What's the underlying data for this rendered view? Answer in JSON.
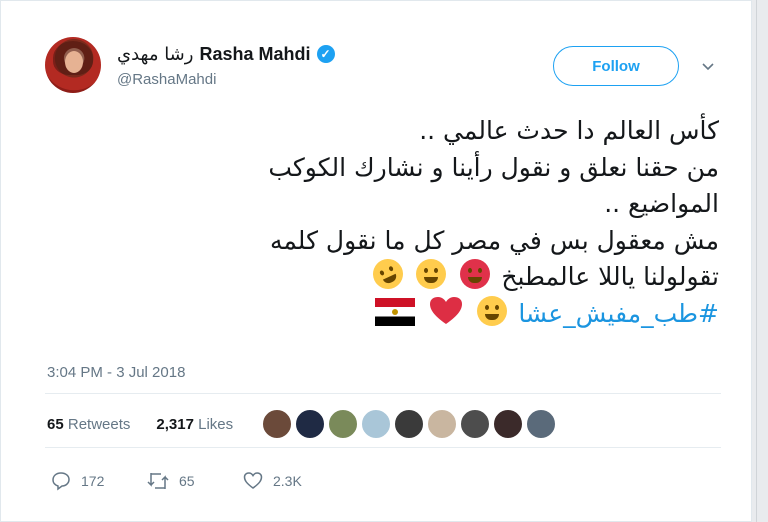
{
  "author": {
    "name_arabic": "رشا مهدي",
    "name_english": "Rasha Mahdi",
    "handle": "@RashaMahdi",
    "verified": true
  },
  "follow_button": {
    "label": "Follow"
  },
  "more_menu": {
    "icon": "chevron-down-icon"
  },
  "tweet": {
    "lines": [
      "كأس العالم دا حدث عالمي ..",
      "من حقنا نعلق و نقول رأينا و نشارك الكوكب",
      "المواضيع ..",
      "مش معقول بس في مصر كل ما نقول كلمه",
      "تقولولنا ياللا عالمطبخ"
    ],
    "line5_emojis": [
      "angry-face",
      "grinning-face",
      "rolling-on-floor-laughing"
    ],
    "hashtag": "#طب_مفيش_عشا",
    "hashtag_emojis": [
      "winking-face-tongue",
      "red-heart",
      "egypt-flag"
    ],
    "hashtag_color": "#1b95e0"
  },
  "timestamp": "3:04 PM - 3 Jul 2018",
  "stats": {
    "retweets_count": "65",
    "retweets_label": "Retweets",
    "likes_count": "2,317",
    "likes_label": "Likes"
  },
  "liker_avatars": [
    {
      "color": "#6b4a3a"
    },
    {
      "color": "#1f2a44"
    },
    {
      "color": "#7a8a5a"
    },
    {
      "color": "#a9c6d8"
    },
    {
      "color": "#3a3a3a"
    },
    {
      "color": "#c9b6a0"
    },
    {
      "color": "#4d4d4d"
    },
    {
      "color": "#3b2a2a"
    },
    {
      "color": "#5a6a7a"
    }
  ],
  "actions": {
    "reply_count": "172",
    "retweet_count": "65",
    "like_count": "2.3K"
  },
  "colors": {
    "accent": "#1da1f2",
    "text": "#14171a",
    "muted": "#657786"
  }
}
